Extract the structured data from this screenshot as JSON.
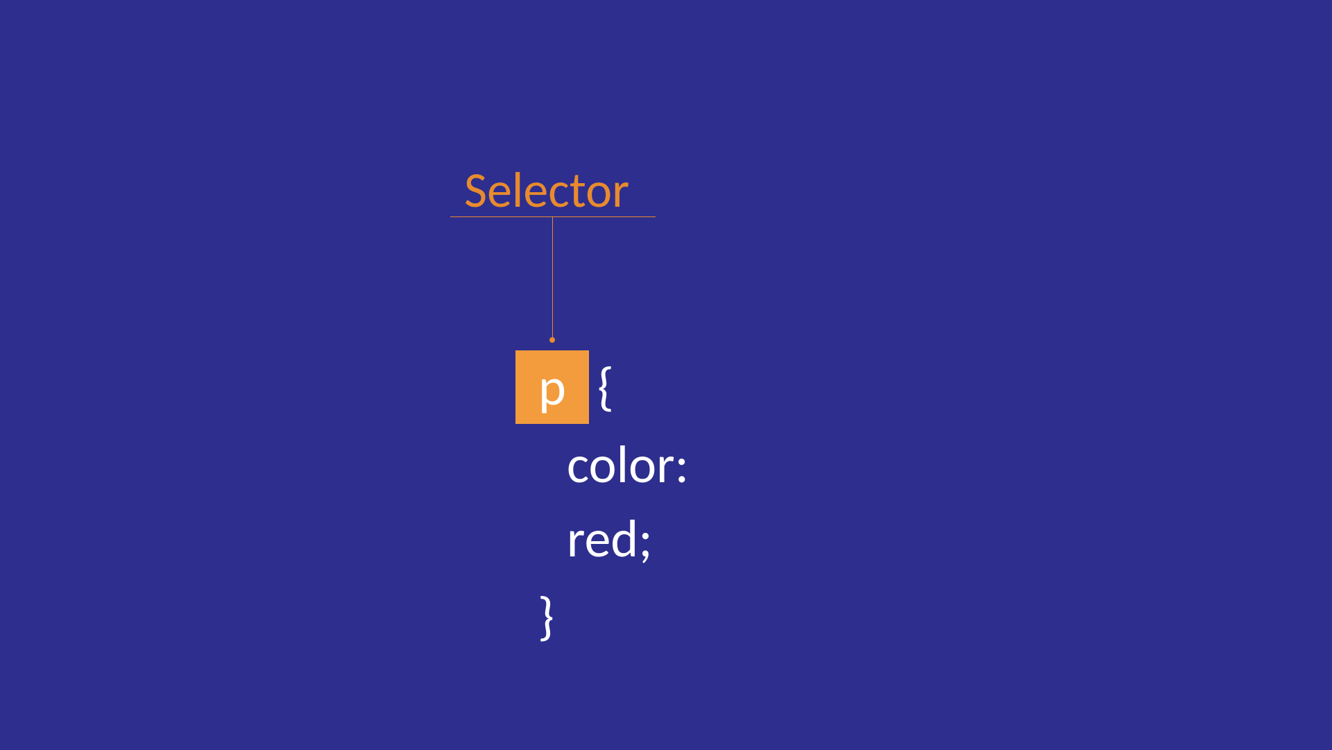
{
  "diagram": {
    "label": "Selector",
    "code": {
      "selector": "p",
      "brace_open": "{",
      "declaration": "color: red;",
      "brace_close": "}"
    }
  }
}
